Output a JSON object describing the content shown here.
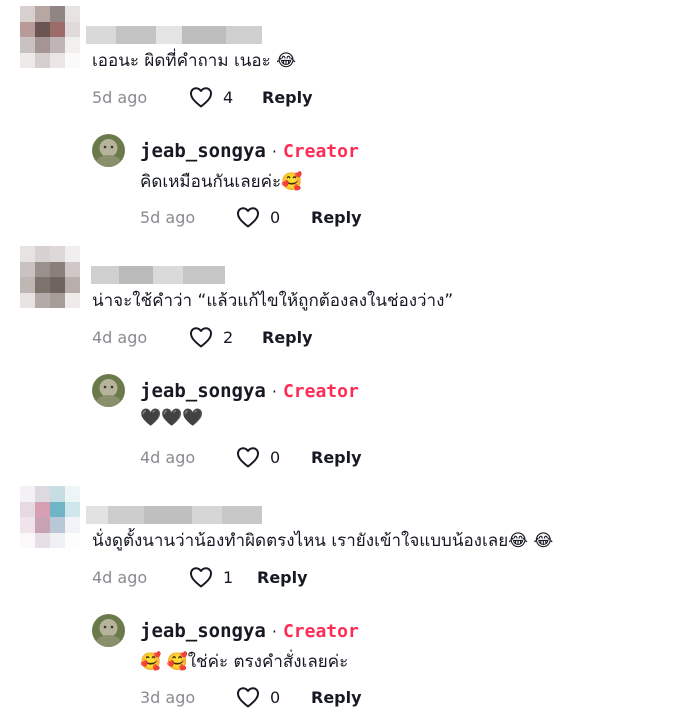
{
  "comments": [
    {
      "text": "เออนะ ผิดที่คำถาม เนอะ 😂",
      "time": "5d ago",
      "likes": "4",
      "reply_label": "Reply",
      "avatar_colors": [
        "#d8d0cf",
        "#b8a6a3",
        "#8f8584",
        "#e8e3e3",
        "#b89a99",
        "#6b5552",
        "#9c6b6a",
        "#e1dada",
        "#c9c2c2",
        "#a49594",
        "#bfb5b4",
        "#f2efef",
        "#efeaea",
        "#d6cfce",
        "#ebe6e6",
        "#fbfafa"
      ],
      "creator_reply": {
        "username": "jeab_songya",
        "separator": "·",
        "badge": "Creator",
        "text": "คิดเหมือนกันเลยค่ะ🥰",
        "time": "5d ago",
        "likes": "0",
        "reply_label": "Reply"
      }
    },
    {
      "text": "น่าจะใช้คำว่า “แล้วแก้ไขให้ถูกต้องลงในช่องว่าง”",
      "time": "4d ago",
      "likes": "2",
      "reply_label": "Reply",
      "avatar_colors": [
        "#e6e3e2",
        "#d7d2d1",
        "#ded9d8",
        "#f0eeee",
        "#c9c2c0",
        "#9a908c",
        "#8a7f7b",
        "#cfc8c6",
        "#bfb7b4",
        "#7e726d",
        "#6f6460",
        "#b8afac",
        "#e7e3e2",
        "#b4aba8",
        "#a69c98",
        "#eeebea"
      ],
      "creator_reply": {
        "username": "jeab_songya",
        "separator": "·",
        "badge": "Creator",
        "text": "🖤🖤🖤",
        "time": "4d ago",
        "likes": "0",
        "reply_label": "Reply"
      }
    },
    {
      "text": "นั่งดูตั้งนานว่าน้องทำผิดตรงไหน เรายังเข้าใจแบบน้องเลย😂 😂",
      "time": "4d ago",
      "likes": "1",
      "reply_label": "Reply",
      "avatar_colors": [
        "#f3f1f3",
        "#ddd9e0",
        "#c7dde4",
        "#eef5f7",
        "#e6d9e2",
        "#d79fb2",
        "#6fb5c6",
        "#cfe6ec",
        "#f0e3ea",
        "#c8a3b4",
        "#b9c8d6",
        "#f1f3f6",
        "#fbf8fa",
        "#e8dfe6",
        "#eef0f4",
        "#fdfdfe"
      ],
      "creator_reply": {
        "username": "jeab_songya",
        "separator": "·",
        "badge": "Creator",
        "text": "🥰 🥰ใช่ค่ะ ตรงคำสั่งเลยค่ะ",
        "time": "3d ago",
        "likes": "0",
        "reply_label": "Reply"
      }
    }
  ],
  "colors": {
    "creator_badge": "#fe2c55",
    "meta_gray": "#8a8b91",
    "text": "#161823"
  },
  "icons": [
    "heart-outline-icon",
    "creator-avatar"
  ]
}
